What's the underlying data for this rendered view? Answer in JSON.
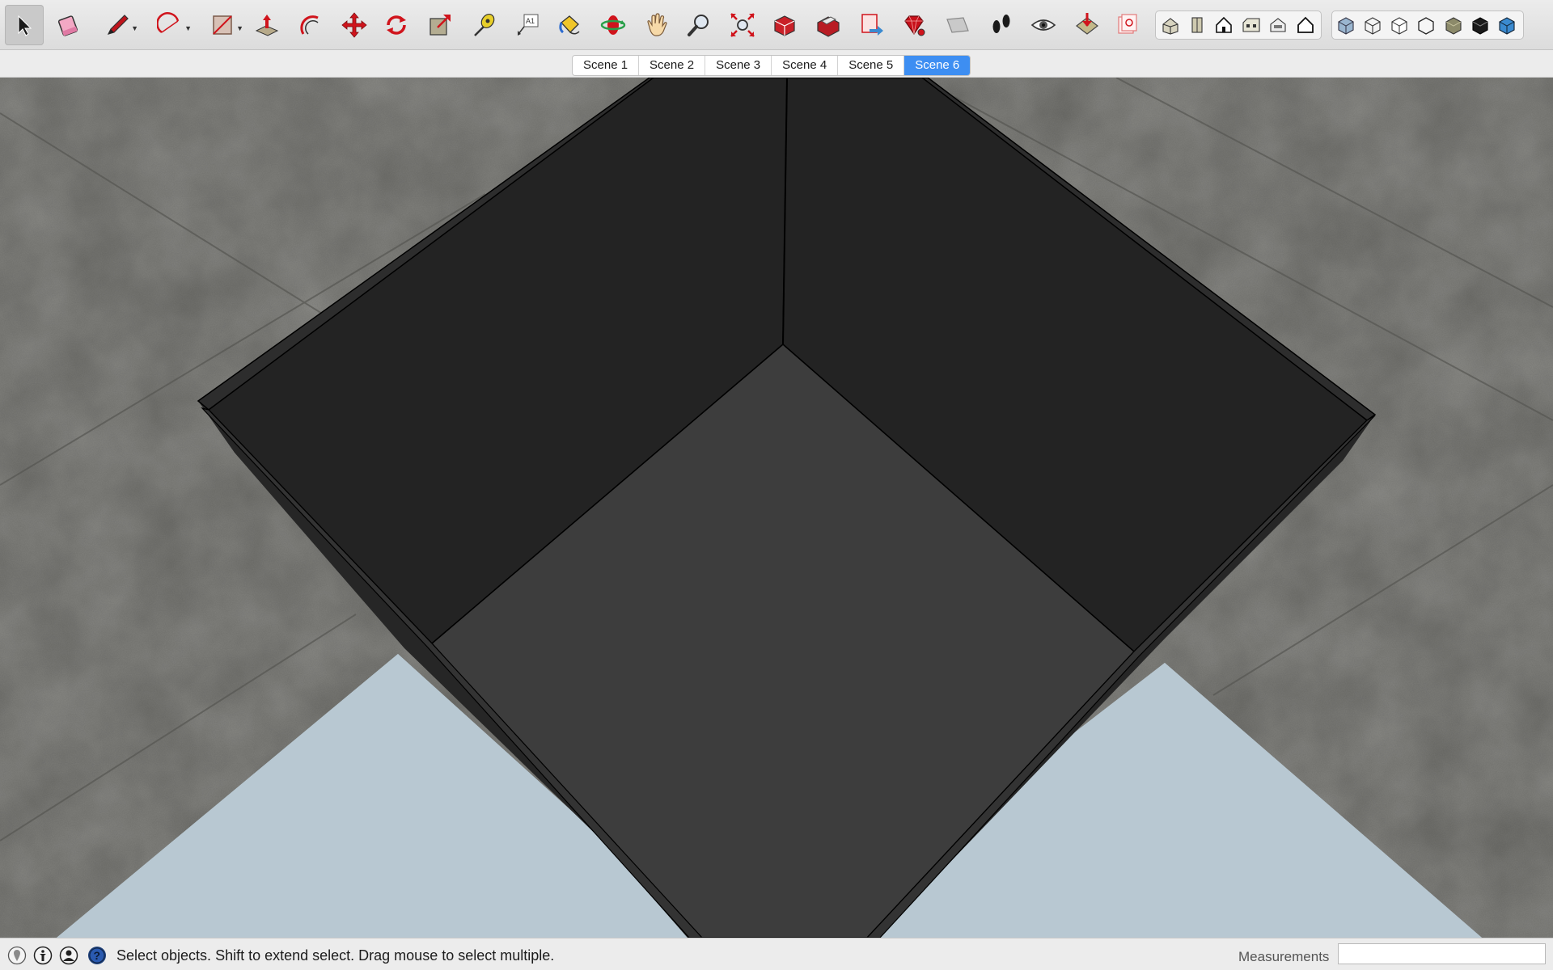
{
  "toolbar": {
    "tools": [
      {
        "name": "select-tool",
        "icon": "arrow-cursor-icon",
        "active": true
      },
      {
        "name": "eraser-tool",
        "icon": "eraser-icon"
      },
      {
        "name": "line-tool",
        "icon": "pencil-icon",
        "dropdown": true
      },
      {
        "name": "arc-tool",
        "icon": "arc-icon",
        "dropdown": true
      },
      {
        "name": "shapes-tool",
        "icon": "rectangle-icon",
        "dropdown": true
      },
      {
        "name": "push-pull-tool",
        "icon": "push-pull-icon"
      },
      {
        "name": "offset-tool",
        "icon": "offset-icon"
      },
      {
        "name": "move-tool",
        "icon": "move-icon"
      },
      {
        "name": "rotate-tool",
        "icon": "rotate-icon"
      },
      {
        "name": "scale-tool",
        "icon": "scale-icon"
      },
      {
        "name": "tape-measure-tool",
        "icon": "tape-measure-icon"
      },
      {
        "name": "text-tool",
        "icon": "text-label-icon"
      },
      {
        "name": "paint-bucket-tool",
        "icon": "paint-bucket-icon"
      },
      {
        "name": "orbit-tool",
        "icon": "orbit-icon"
      },
      {
        "name": "pan-tool",
        "icon": "hand-icon"
      },
      {
        "name": "zoom-tool",
        "icon": "magnifier-icon"
      },
      {
        "name": "zoom-extents-tool",
        "icon": "zoom-extents-icon"
      },
      {
        "name": "warehouse-tool",
        "icon": "3d-warehouse-icon"
      },
      {
        "name": "extension-warehouse-tool",
        "icon": "extension-warehouse-icon"
      },
      {
        "name": "send-to-layout-tool",
        "icon": "send-to-layout-icon"
      },
      {
        "name": "extension-manager-tool",
        "icon": "ruby-gem-icon"
      },
      {
        "name": "section-plane-tool",
        "icon": "section-plane-icon"
      },
      {
        "name": "walk-tool",
        "icon": "footprints-icon"
      },
      {
        "name": "look-around-tool",
        "icon": "eye-icon"
      },
      {
        "name": "position-camera-tool",
        "icon": "position-camera-icon"
      },
      {
        "name": "add-location-tool",
        "icon": "location-icon"
      }
    ],
    "views": [
      {
        "name": "iso-view",
        "icon": "iso-house-icon"
      },
      {
        "name": "top-view",
        "icon": "top-view-icon"
      },
      {
        "name": "front-view",
        "icon": "front-house-icon"
      },
      {
        "name": "right-view",
        "icon": "right-house-icon"
      },
      {
        "name": "back-view",
        "icon": "back-house-icon"
      },
      {
        "name": "left-view",
        "icon": "left-house-icon"
      }
    ],
    "styles": [
      {
        "name": "xray-style",
        "icon": "xray-cube-icon"
      },
      {
        "name": "wireframe-style",
        "icon": "wireframe-cube-icon"
      },
      {
        "name": "hidden-line-style",
        "icon": "hidden-line-cube-icon"
      },
      {
        "name": "shaded-style",
        "icon": "white-cube-icon"
      },
      {
        "name": "shaded-textures-style",
        "icon": "textured-cube-icon"
      },
      {
        "name": "monochrome-style",
        "icon": "black-cube-icon"
      },
      {
        "name": "back-edges-style",
        "icon": "blue-cube-icon"
      }
    ]
  },
  "scene_tabs": [
    "Scene 1",
    "Scene 2",
    "Scene 3",
    "Scene 4",
    "Scene 5",
    "Scene 6"
  ],
  "active_scene": "Scene 6",
  "viewport": {
    "description_free": true,
    "colors": {
      "concrete": "#6b6b67",
      "floor": "#b8c8d2",
      "box_wall": "#222222",
      "box_floor": "#3d3d3d",
      "rim": "#2e2e2e"
    }
  },
  "status": {
    "icons": [
      "geolocation-icon",
      "credits-icon",
      "account-icon",
      "help-icon"
    ],
    "message": "Select objects. Shift to extend select. Drag mouse to select multiple.",
    "measurements_label": "Measurements",
    "measurements_value": ""
  },
  "colors": {
    "accent": "#3d8ef2",
    "toolbar_bg": "#e4e4e4"
  }
}
